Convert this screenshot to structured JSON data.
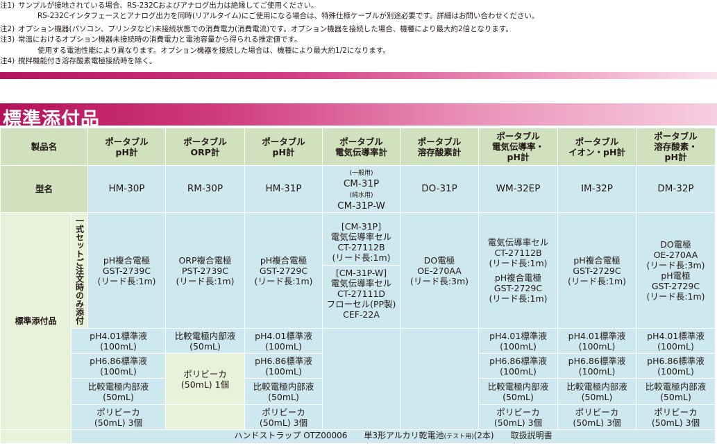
{
  "notes": [
    {
      "tag": "注1)",
      "text": "サンプルが接地されている場合、RS-232Cおよびアナログ出力は絶縁してご使用ください。"
    },
    {
      "tag": "",
      "text": "RS-232Cインタフェースとアナログ出力を同時(リアルタイム)にご使用になる場合は、特殊仕様ケーブルが別途必要です。詳細はお問い合わせください。"
    },
    {
      "tag": "注2)",
      "text": "オプション機器(パソコン、プリンタなど)未接続状態での消費電力(消費電流)です。オプション機器を接続した場合、機種により最大約2倍となります。"
    },
    {
      "tag": "注3)",
      "text": "常温におけるオプション機器未接続時の消費電力と電池容量から得られる推定値です。"
    },
    {
      "tag": "",
      "text": "使用する電池性能により異なります。オプション機器を接続した場合は、機種により最大約1/2になります。"
    },
    {
      "tag": "注4)",
      "text": "撹拌機能付き溶存酸素電極接続時を除く。"
    }
  ],
  "section_title": "標準添付品",
  "table": {
    "product_header": "製品名",
    "model_header": "型名",
    "accessories_header": "標準添付品",
    "set_only_label": "一式セットご注文時のみ添付",
    "products": [
      [
        "ポータブル",
        "pH計"
      ],
      [
        "ポータブル",
        "ORP計"
      ],
      [
        "ポータブル",
        "pH計"
      ],
      [
        "ポータブル",
        "電気伝導率計"
      ],
      [
        "ポータブル",
        "溶存酸素計"
      ],
      [
        "ポータブル",
        "電気伝導率・",
        "pH計"
      ],
      [
        "ポータブル",
        "イオン・pH計"
      ],
      [
        "ポータブル",
        "溶存酸素・",
        "pH計"
      ]
    ],
    "models": {
      "hm30p": "HM-30P",
      "rm30p": "RM-30P",
      "hm31p": "HM-31P",
      "cm31p_general_note": "(一般用)",
      "cm31p": "CM-31P",
      "cm31p_pure_note": "(純水用)",
      "cm31pw": "CM-31P-W",
      "do31p": "DO-31P",
      "wm32ep": "WM-32EP",
      "im32p": "IM-32P",
      "dm32p": "DM-32P"
    },
    "set_items": {
      "hm30p": [
        "pH複合電極",
        "GST-2739C",
        "(リード長:1m)"
      ],
      "rm30p": [
        "ORP複合電極",
        "PST-2739C",
        "(リード長:1m)"
      ],
      "hm31p": [
        "pH複合電極",
        "GST-2729C",
        "(リード長:1m)"
      ],
      "cm31p_a": [
        "[CM-31P]",
        "電気伝導率セル",
        "CT-27112B",
        "(リード長:1m)"
      ],
      "cm31p_b": [
        "[CM-31P-W]",
        "電気伝導率セル",
        "CT-27111D",
        "フローセル(PP製)",
        "CEF-22A"
      ],
      "do31p": [
        "DO電極",
        "OE-270AA",
        "(リード長:3m)"
      ],
      "wm32ep": [
        "電気伝導率セル",
        "CT-27112B",
        "(リード長:1m)",
        "pH複合電極",
        "GST-2729C",
        "(リード長:1m)"
      ],
      "im32p": [
        "pH複合電極",
        "GST-2729C",
        "(リード長:1m)"
      ],
      "dm32p": [
        "DO電極",
        "OE-270AA",
        "(リード長:3m)",
        "pH電極",
        "GST-2729C",
        "(リード長:1m)"
      ]
    },
    "std": {
      "ph401": [
        "pH4.01標準液",
        "(100mL)"
      ],
      "ref_sol": [
        "比較電極内部液",
        "(50mL)"
      ],
      "ph686": [
        "pH6.86標準液",
        "(100mL)"
      ],
      "beaker_one": [
        "ポリビーカ",
        "(50mL) 1個"
      ],
      "beaker_three": [
        "ポリビーカ",
        "(50mL) 3個"
      ]
    },
    "footer": {
      "text1": "ハンドストラップ OTZ00006　　単3形アルカリ乾電池",
      "small": "(テスト用)",
      "text2": "(2本)　　取扱説明書"
    }
  }
}
